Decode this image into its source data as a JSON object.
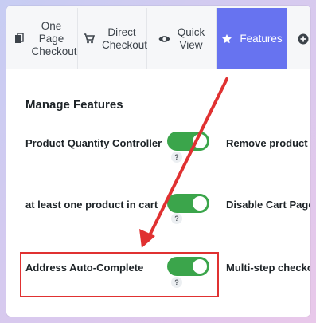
{
  "tabs": [
    {
      "label": "One Page Checkout",
      "icon": "pages-icon"
    },
    {
      "label": "Direct Checkout",
      "icon": "cart-icon"
    },
    {
      "label": "Quick View",
      "icon": "eye-icon"
    },
    {
      "label": "Features",
      "icon": "star-icon",
      "active": true
    },
    {
      "label": "",
      "icon": "plus-circle-icon"
    }
  ],
  "colors": {
    "accent": "#6773f0",
    "toggle_on": "#3ba54b",
    "highlight": "#e03131"
  },
  "main": {
    "title": "Manage Features",
    "rows": [
      {
        "left_label": "Product Quantity Controller",
        "toggle": "on",
        "help": "?",
        "right_label": "Remove product Bu"
      },
      {
        "left_label": "at least one product in cart",
        "toggle": "on",
        "help": "?",
        "right_label": "Disable Cart Page"
      },
      {
        "left_label": "Address Auto-Complete",
        "toggle": "on",
        "help": "?",
        "right_label": "Multi-step checkou"
      }
    ]
  }
}
